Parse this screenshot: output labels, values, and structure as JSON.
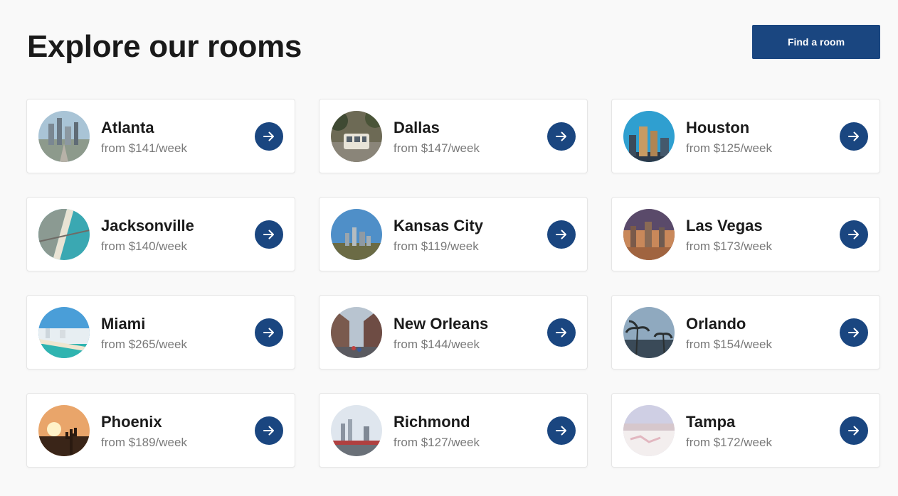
{
  "page": {
    "title": "Explore our rooms",
    "cta_label": "Find a room"
  },
  "colors": {
    "accent": "#1a4680",
    "background": "#f9f9f9",
    "card": "#ffffff",
    "price_text": "#7a7a7a"
  },
  "rooms": [
    {
      "city": "Atlanta",
      "price": "from $141/week",
      "thumb": "city-skyline-photo"
    },
    {
      "city": "Dallas",
      "price": "from $147/week",
      "thumb": "streetcar-photo"
    },
    {
      "city": "Houston",
      "price": "from $125/week",
      "thumb": "downtown-towers-photo"
    },
    {
      "city": "Jacksonville",
      "price": "from $140/week",
      "thumb": "beach-aerial-photo"
    },
    {
      "city": "Kansas City",
      "price": "from $119/week",
      "thumb": "skyline-photo"
    },
    {
      "city": "Las Vegas",
      "price": "from $173/week",
      "thumb": "sunset-city-photo"
    },
    {
      "city": "Miami",
      "price": "from $265/week",
      "thumb": "beach-coast-photo"
    },
    {
      "city": "New Orleans",
      "price": "from $144/week",
      "thumb": "street-photo"
    },
    {
      "city": "Orlando",
      "price": "from $154/week",
      "thumb": "palm-trees-photo"
    },
    {
      "city": "Phoenix",
      "price": "from $189/week",
      "thumb": "desert-sunset-photo"
    },
    {
      "city": "Richmond",
      "price": "from $127/week",
      "thumb": "city-bridge-photo"
    },
    {
      "city": "Tampa",
      "price": "from $172/week",
      "thumb": "white-beach-photo"
    }
  ],
  "icons": {
    "card_action": "arrow-right-icon"
  }
}
